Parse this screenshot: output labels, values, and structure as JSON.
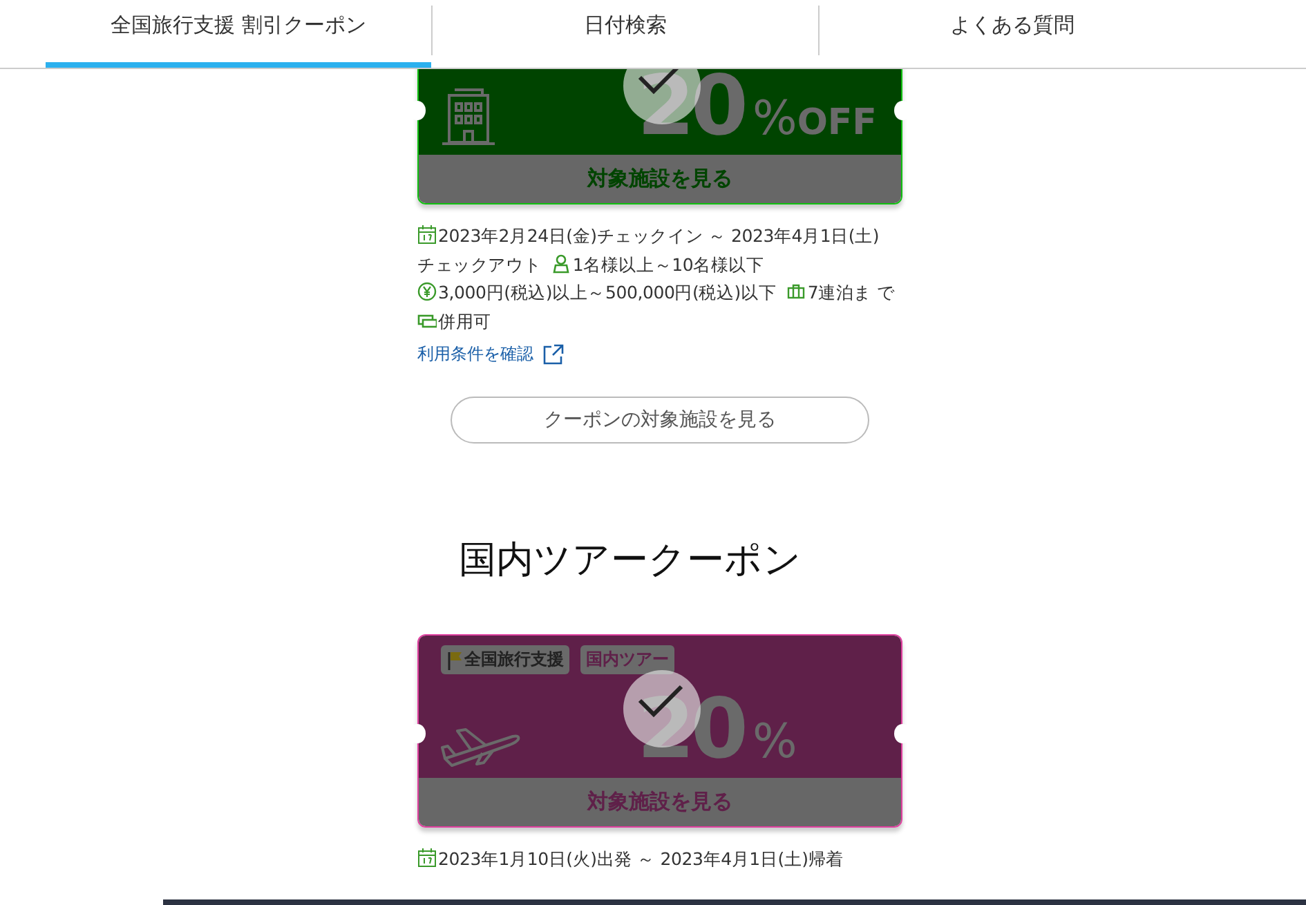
{
  "tabs": [
    {
      "label": "全国旅行支援 割引クーポン",
      "selected": true
    },
    {
      "label": "日付検索",
      "selected": false
    },
    {
      "label": "よくある質問",
      "selected": false
    }
  ],
  "coupon_groups": [
    {
      "coupons": [
        {
          "kind": "hotel",
          "used": true,
          "discount": "20",
          "unit": "%",
          "suffix": "OFF",
          "button": "対象施設を見る",
          "details": [
            {
              "kind": "date",
              "parts": [
                "2023年2月24日(金)チェックイン ～ 2023年4月1日(土)",
                "チェックアウト"
              ]
            },
            {
              "kind": "people",
              "parts": [
                "1名様以上～10名様以下"
              ]
            },
            {
              "kind": "price",
              "parts": [
                "3,000円(税込)以上～500,000円(税込)以下"
              ]
            },
            {
              "kind": "nights",
              "parts": [
                "7連泊ま",
                "で"
              ]
            },
            {
              "kind": "combine",
              "parts": [
                "併用可"
              ]
            }
          ],
          "terms_link": "利用条件を確認"
        }
      ],
      "more_button": "クーポンの対象施設を見る"
    },
    {
      "heading": "国内ツアークーポン",
      "coupons": [
        {
          "kind": "tour",
          "used": true,
          "tags": [
            {
              "kind": "flag",
              "label": "全国旅行支援"
            },
            {
              "kind": "plain",
              "label": "国内ツアー"
            }
          ],
          "discount": "20",
          "unit": "%",
          "button": "対象施設を見る",
          "details": [
            {
              "kind": "date",
              "parts": [
                "2023年1月10日(火)出発 ～ 2023年4月1日(土)帰着"
              ]
            }
          ]
        }
      ]
    }
  ]
}
